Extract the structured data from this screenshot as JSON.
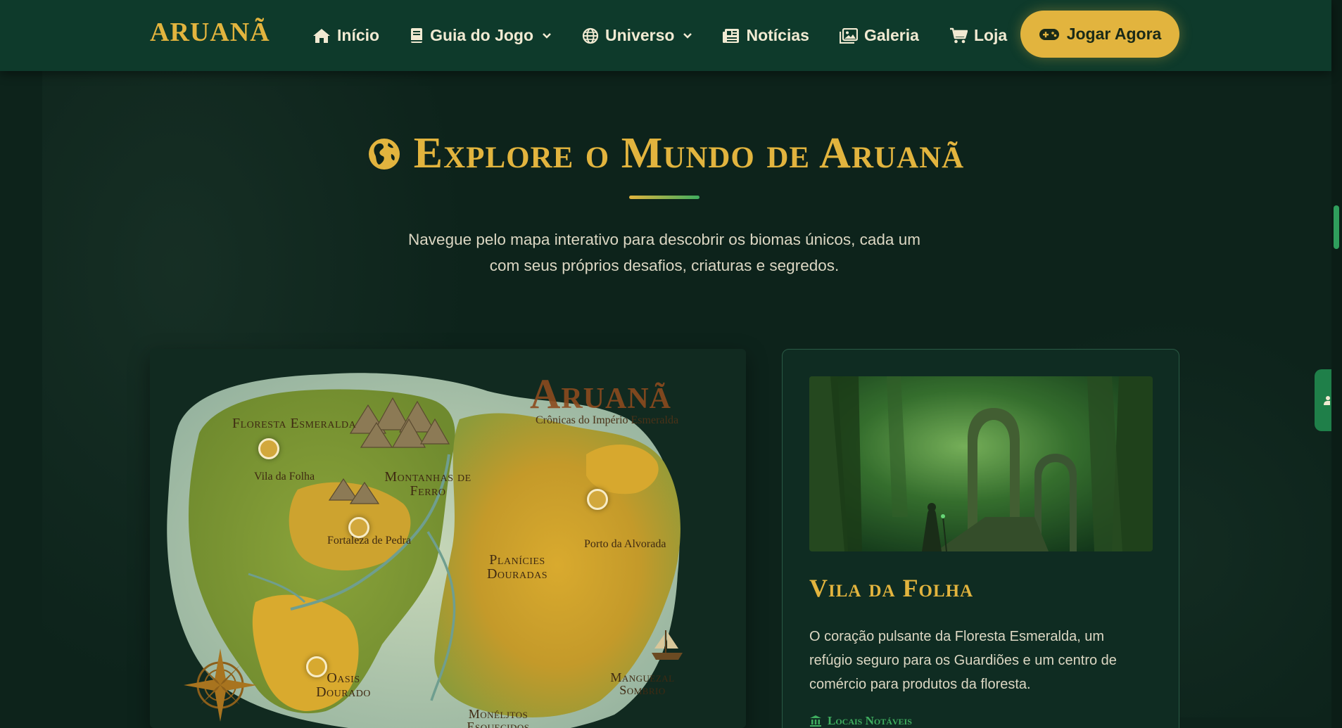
{
  "nav": {
    "logo": "ARUANÃ",
    "items": [
      {
        "label": "Início",
        "icon": "home-icon"
      },
      {
        "label": "Guia do Jogo",
        "icon": "book-icon",
        "dropdown": true
      },
      {
        "label": "Universo",
        "icon": "globe-icon",
        "dropdown": true
      },
      {
        "label": "Notícias",
        "icon": "newspaper-icon"
      },
      {
        "label": "Galeria",
        "icon": "images-icon"
      },
      {
        "label": "Loja",
        "icon": "cart-icon"
      }
    ],
    "cta": {
      "label": "Jogar Agora",
      "icon": "gamepad-icon"
    }
  },
  "section": {
    "title": "Explore o Mundo de Aruanã",
    "subtitle": "Navegue pelo mapa interativo para descobrir os biomas únicos, cada um com seus próprios desafios, criaturas e segredos."
  },
  "map": {
    "title": "Aruanã",
    "subtitle": "Crônicas do Império Esmeralda",
    "biomes": [
      "Floresta Esmeralda",
      "Montanhas de Ferro",
      "Planícies Douradas",
      "Oasis Dourado",
      "Manguezal Sombrio",
      "Monéljtos Esquecidos"
    ],
    "towns": [
      "Vila da Folha",
      "Fortaleza de Pedra",
      "Porto da Alvorada"
    ]
  },
  "info": {
    "title": "Vila da Folha",
    "description": "O coração pulsante da Floresta Esmeralda, um refúgio seguro para os Guardiões e um centro de comércio para produtos da floresta.",
    "subheading": "Locais Notáveis"
  },
  "colors": {
    "background": "#0d231b",
    "navbar": "#0e3a2b",
    "accent_gold": "#e2b43e",
    "accent_green": "#3fae5f"
  }
}
